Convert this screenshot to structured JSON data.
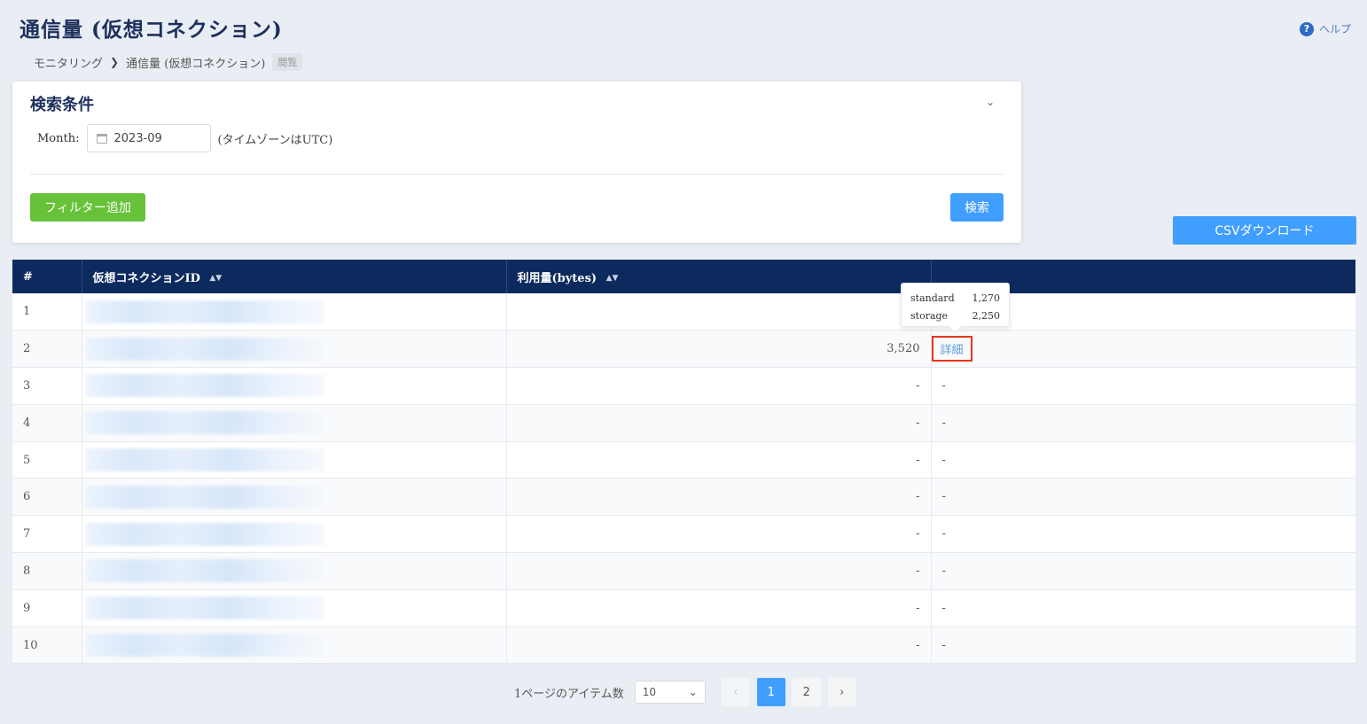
{
  "header": {
    "title": "通信量 (仮想コネクション)",
    "help_label": "ヘルプ",
    "help_icon": "?"
  },
  "breadcrumb": {
    "items": [
      "モニタリング",
      "通信量 (仮想コネクション)"
    ],
    "separator": "❯",
    "badge": "閲覧"
  },
  "search": {
    "title": "検索条件",
    "collapse_icon": "⌄",
    "month_label": "Month:",
    "month_value": "2023-09",
    "timezone_note": "(タイムゾーンはUTC)",
    "add_filter_label": "フィルター追加",
    "search_label": "検索"
  },
  "csv_download_label": "CSVダウンロード",
  "table": {
    "headers": {
      "index": "#",
      "connection_id": "仮想コネクションID",
      "usage": "利用量(bytes)",
      "actions": ""
    },
    "sort_icon": "▲▼",
    "rows": [
      {
        "index": "1",
        "usage": "",
        "action": ""
      },
      {
        "index": "2",
        "usage": "3,520",
        "action": "詳細"
      },
      {
        "index": "3",
        "usage": "-",
        "action": "-"
      },
      {
        "index": "4",
        "usage": "-",
        "action": "-"
      },
      {
        "index": "5",
        "usage": "-",
        "action": "-"
      },
      {
        "index": "6",
        "usage": "-",
        "action": "-"
      },
      {
        "index": "7",
        "usage": "-",
        "action": "-"
      },
      {
        "index": "8",
        "usage": "-",
        "action": "-"
      },
      {
        "index": "9",
        "usage": "-",
        "action": "-"
      },
      {
        "index": "10",
        "usage": "-",
        "action": "-"
      }
    ]
  },
  "tooltip": {
    "rows": [
      {
        "label": "standard",
        "value": "1,270"
      },
      {
        "label": "storage",
        "value": "2,250"
      }
    ]
  },
  "pagination": {
    "per_page_label": "1ページのアイテム数",
    "per_page_value": "10",
    "prev": "‹",
    "next": "›",
    "pages": [
      "1",
      "2"
    ],
    "current": "1"
  },
  "colors": {
    "header_bg": "#0d2a5e",
    "primary": "#409eff",
    "success": "#67c23a",
    "highlight_border": "#e8361e"
  }
}
